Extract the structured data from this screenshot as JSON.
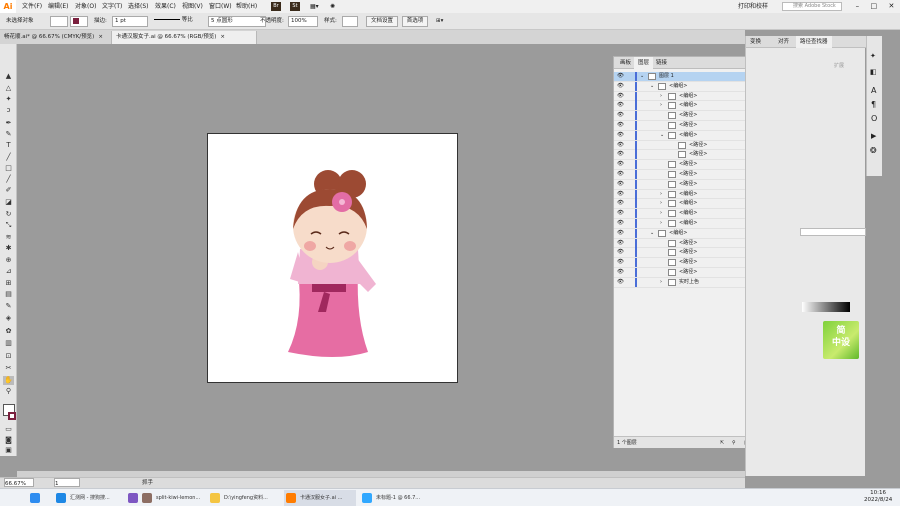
{
  "app": {
    "logo": "Ai",
    "accent": "#ff7c00"
  },
  "menu": [
    "文件(F)",
    "编辑(E)",
    "对象(O)",
    "文字(T)",
    "选择(S)",
    "效果(C)",
    "视图(V)",
    "窗口(W)",
    "帮助(H)"
  ],
  "workspace": {
    "label": "打印和校样",
    "search_placeholder": "搜索 Adobe Stock"
  },
  "control_bar": {
    "no_selection": "未选择对象",
    "stroke_label": "描边:",
    "stroke_value": "1 pt",
    "stroke_profile": "等比",
    "brush_value": "5 点圆形",
    "opacity_label": "不透明度:",
    "opacity_value": "100%",
    "style_label": "样式:",
    "doc_setup": "文档设置",
    "preferences": "首选项"
  },
  "tabs": [
    {
      "label": "畅花顺.ai* @ 66.67% (CMYK/预览)"
    },
    {
      "label": "卡通汉服女子.ai @ 66.67% (RGB/预览)"
    }
  ],
  "layers_panel": {
    "tabs": [
      "画板",
      "图层",
      "链接"
    ],
    "active_tab": "图层",
    "rows": [
      {
        "name": "图层 1",
        "level": 0,
        "twirl": "open",
        "selected": true
      },
      {
        "name": "<编组>",
        "level": 1,
        "twirl": "open"
      },
      {
        "name": "<编组>",
        "level": 2,
        "twirl": "closed"
      },
      {
        "name": "<编组>",
        "level": 2,
        "twirl": "closed"
      },
      {
        "name": "<路径>",
        "level": 2,
        "twirl": "none"
      },
      {
        "name": "<路径>",
        "level": 2,
        "twirl": "none"
      },
      {
        "name": "<编组>",
        "level": 2,
        "twirl": "open"
      },
      {
        "name": "<路径>",
        "level": 3,
        "twirl": "none"
      },
      {
        "name": "<路径>",
        "level": 3,
        "twirl": "none"
      },
      {
        "name": "<路径>",
        "level": 2,
        "twirl": "none"
      },
      {
        "name": "<路径>",
        "level": 2,
        "twirl": "none"
      },
      {
        "name": "<路径>",
        "level": 2,
        "twirl": "none"
      },
      {
        "name": "<编组>",
        "level": 2,
        "twirl": "closed"
      },
      {
        "name": "<编组>",
        "level": 2,
        "twirl": "closed"
      },
      {
        "name": "<编组>",
        "level": 2,
        "twirl": "closed"
      },
      {
        "name": "<编组>",
        "level": 2,
        "twirl": "closed"
      },
      {
        "name": "<编组>",
        "level": 1,
        "twirl": "open"
      },
      {
        "name": "<路径>",
        "level": 2,
        "twirl": "none"
      },
      {
        "name": "<路径>",
        "level": 2,
        "twirl": "none"
      },
      {
        "name": "<路径>",
        "level": 2,
        "twirl": "none"
      },
      {
        "name": "<路径>",
        "level": 2,
        "twirl": "none"
      },
      {
        "name": "实时上色",
        "level": 2,
        "twirl": "closed"
      }
    ],
    "footer": "1 个图层"
  },
  "right_panel": {
    "tabs": [
      "变换",
      "对齐",
      "路径查找器"
    ],
    "label": "扩展"
  },
  "status": {
    "zoom": "66.67%",
    "artboard": "1",
    "tool": "抓手"
  },
  "taskbar": {
    "items": [
      {
        "label": "",
        "color": "#2d8cf0"
      },
      {
        "label": "汇测网 - 搜狗搜...",
        "color": "#1e88e5"
      },
      {
        "label": "",
        "color": "#7e57c2"
      },
      {
        "label": "split-kiwi-lemon...",
        "color": "#8d6e63"
      },
      {
        "label": "D:\\yingfeng资料...",
        "color": "#f4c542"
      },
      {
        "label": "卡通汉服女子.ai ...",
        "color": "#ff7c00"
      },
      {
        "label": "未标题-1 @ 66.7...",
        "color": "#31a8ff"
      }
    ],
    "time": "10:16",
    "date": "2022/8/24"
  },
  "greenimg_text": "简\n中设"
}
